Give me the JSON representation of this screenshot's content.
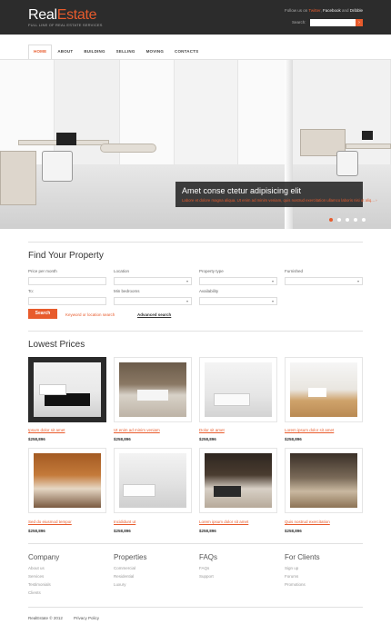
{
  "header": {
    "logo_main": "Real",
    "logo_accent": "Estate",
    "tagline": "FULL LINE OF REAL ESTATE SERVICES",
    "follow_prefix": "Follow us on ",
    "follow_twitter": "Twitter",
    "follow_sep1": ", ",
    "follow_facebook": "Facebook",
    "follow_sep2": " and ",
    "follow_dribbble": "Dribble",
    "search_label": "Search:",
    "search_button": "›"
  },
  "nav": [
    "HOME",
    "ABOUT",
    "BUILDING",
    "SELLING",
    "MOVING",
    "CONTACTS"
  ],
  "hero": {
    "caption_title": "Amet conse ctetur adipisicing elit",
    "caption_text": "Labore et dolore magna aliqua. Ut enim ad minim veniam, quis nostrud exercitation ullamco laboris nisi ut aliq...",
    "caption_more": "›"
  },
  "find": {
    "title": "Find Your Property",
    "labels": [
      "Price per month",
      "Location",
      "Property type",
      "Furnished",
      "To:",
      "Min bedrooms",
      "Availability"
    ],
    "search_button": "Search",
    "keyword_text": "Keyword or location search",
    "advanced_link": "Advanced search"
  },
  "lowest": {
    "title": "Lowest Prices",
    "items": [
      {
        "name": "Ipsum dolor sit amet",
        "price": "$258,896"
      },
      {
        "name": "Ut enim ad minim veniam",
        "price": "$258,896"
      },
      {
        "name": "Dolor sit amet",
        "price": "$258,896"
      },
      {
        "name": "Lorem ipsum dolor sit amet",
        "price": "$258,896"
      },
      {
        "name": "Sed do eiusmod tempor",
        "price": "$258,896"
      },
      {
        "name": "Incididunt ut",
        "price": "$258,896"
      },
      {
        "name": "Lorem ipsum dolor sit amet",
        "price": "$258,896"
      },
      {
        "name": "Quis nostrud exercitation",
        "price": "$258,896"
      }
    ]
  },
  "footer": {
    "columns": [
      {
        "title": "Company",
        "links": [
          "About us",
          "Services",
          "Testimonials",
          "Clients"
        ]
      },
      {
        "title": "Properties",
        "links": [
          "Commercial",
          "Residential",
          "Luxury"
        ]
      },
      {
        "title": "FAQs",
        "links": [
          "FAQs",
          "Support"
        ]
      },
      {
        "title": "For Clients",
        "links": [
          "Sign up",
          "Forums",
          "Promotions"
        ]
      }
    ],
    "copyright": "RealEstate © 2012",
    "privacy": "Privacy Policy"
  },
  "colors": {
    "accent": "#e85b2c",
    "topbar": "#2c2c2c"
  }
}
